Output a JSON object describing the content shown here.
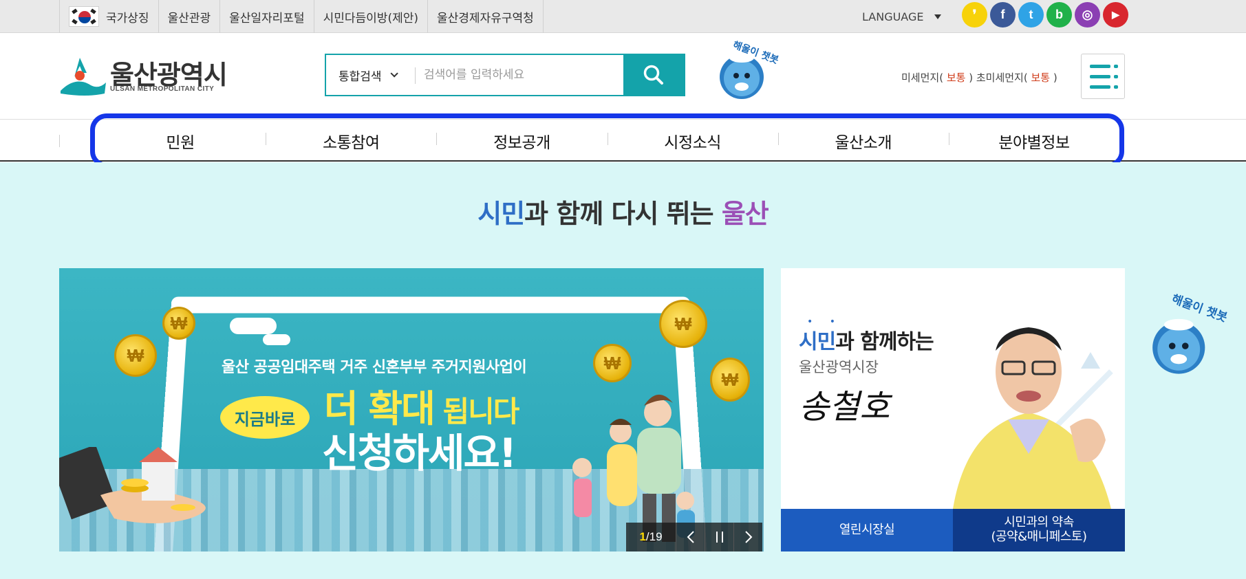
{
  "topbar": {
    "links": [
      "국가상징",
      "울산관광",
      "울산일자리포털",
      "시민다듬이방(제안)",
      "울산경제자유구역청"
    ],
    "language": "LANGUAGE",
    "socials": [
      {
        "name": "kakaostory",
        "glyph": "❜",
        "color": "#f7d20a"
      },
      {
        "name": "facebook",
        "glyph": "f",
        "color": "#3b5998"
      },
      {
        "name": "twitter",
        "glyph": "t",
        "color": "#2fa3e6"
      },
      {
        "name": "blog",
        "glyph": "b",
        "color": "#20b14a"
      },
      {
        "name": "instagram",
        "glyph": "◎",
        "color": "#8b3fb3"
      },
      {
        "name": "youtube",
        "glyph": "▶",
        "color": "#d8262e"
      }
    ]
  },
  "header": {
    "logo_text": "울산광역시",
    "logo_sub": "ULSAN METROPOLITAN CITY",
    "search_scope": "통합검색",
    "search_placeholder": "검색어를 입력하세요",
    "chatbot_label": "해울이 챗봇",
    "dust": {
      "pm10_label": "미세먼지(",
      "pm10_status": "보통",
      "pm25_label": " ) 초미세먼지(",
      "pm25_status": "보통",
      "close": " )"
    }
  },
  "gnb": [
    "민원",
    "소통참여",
    "정보공개",
    "시정소식",
    "울산소개",
    "분야별정보"
  ],
  "main": {
    "slogan": {
      "p1": "시민",
      "p2": "과 함께 다시 뛰는 ",
      "p3": "울산"
    },
    "banner": {
      "line1": "울산 공공임대주택 거주 신혼부부 주거지원사업이",
      "line2a": "더 확대",
      "line2b": " 됩니다",
      "badge": "지금바로",
      "line3": "신청하세요!",
      "coin_symbol": "₩",
      "current": "1",
      "sep": " / ",
      "total": "19"
    },
    "mayor": {
      "title_a": "시민",
      "title_b": "과 함께하는",
      "subtitle": "울산광역시장",
      "signature": "송철호",
      "btn_open": "열린시장실",
      "btn_promise_1": "시민과의 약속",
      "btn_promise_2": "(공약&매니페스토)"
    }
  },
  "colors": {
    "accent": "#14a3aa",
    "gnb_highlight": "#1536e8",
    "main_bg": "#d9f7f7"
  }
}
